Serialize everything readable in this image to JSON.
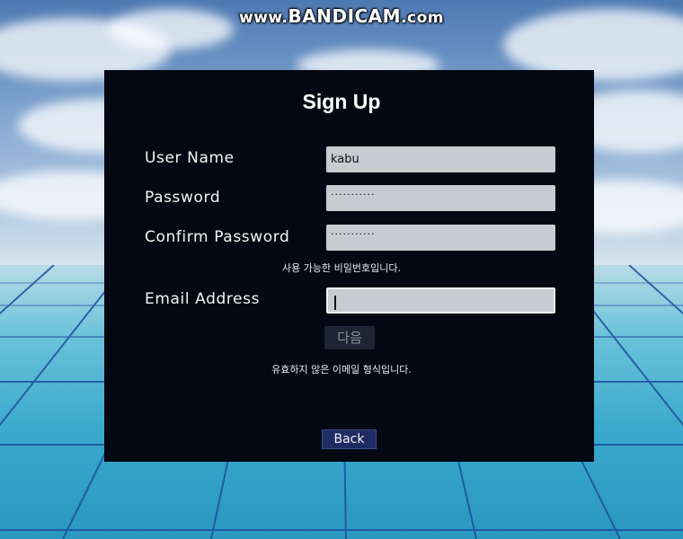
{
  "watermark": {
    "prefix": "www.",
    "brand": "BANDICAM",
    "suffix": ".com"
  },
  "signup": {
    "title": "Sign Up",
    "username_label": "User Name",
    "username_value": "kabu",
    "password_label": "Password",
    "password_value": "···········",
    "confirm_label": "Confirm Password",
    "confirm_value": "···········",
    "password_message": "사용 가능한 비밀번호입니다.",
    "email_label": "Email Address",
    "email_value": "",
    "next_label": "다음",
    "email_message": "유효하지 않은 이메일 형식입니다.",
    "back_label": "Back"
  },
  "colors": {
    "panel": "#040812",
    "field": "#c8cbd0",
    "back_button": "#1e2c63",
    "next_button": "#1d2434"
  }
}
